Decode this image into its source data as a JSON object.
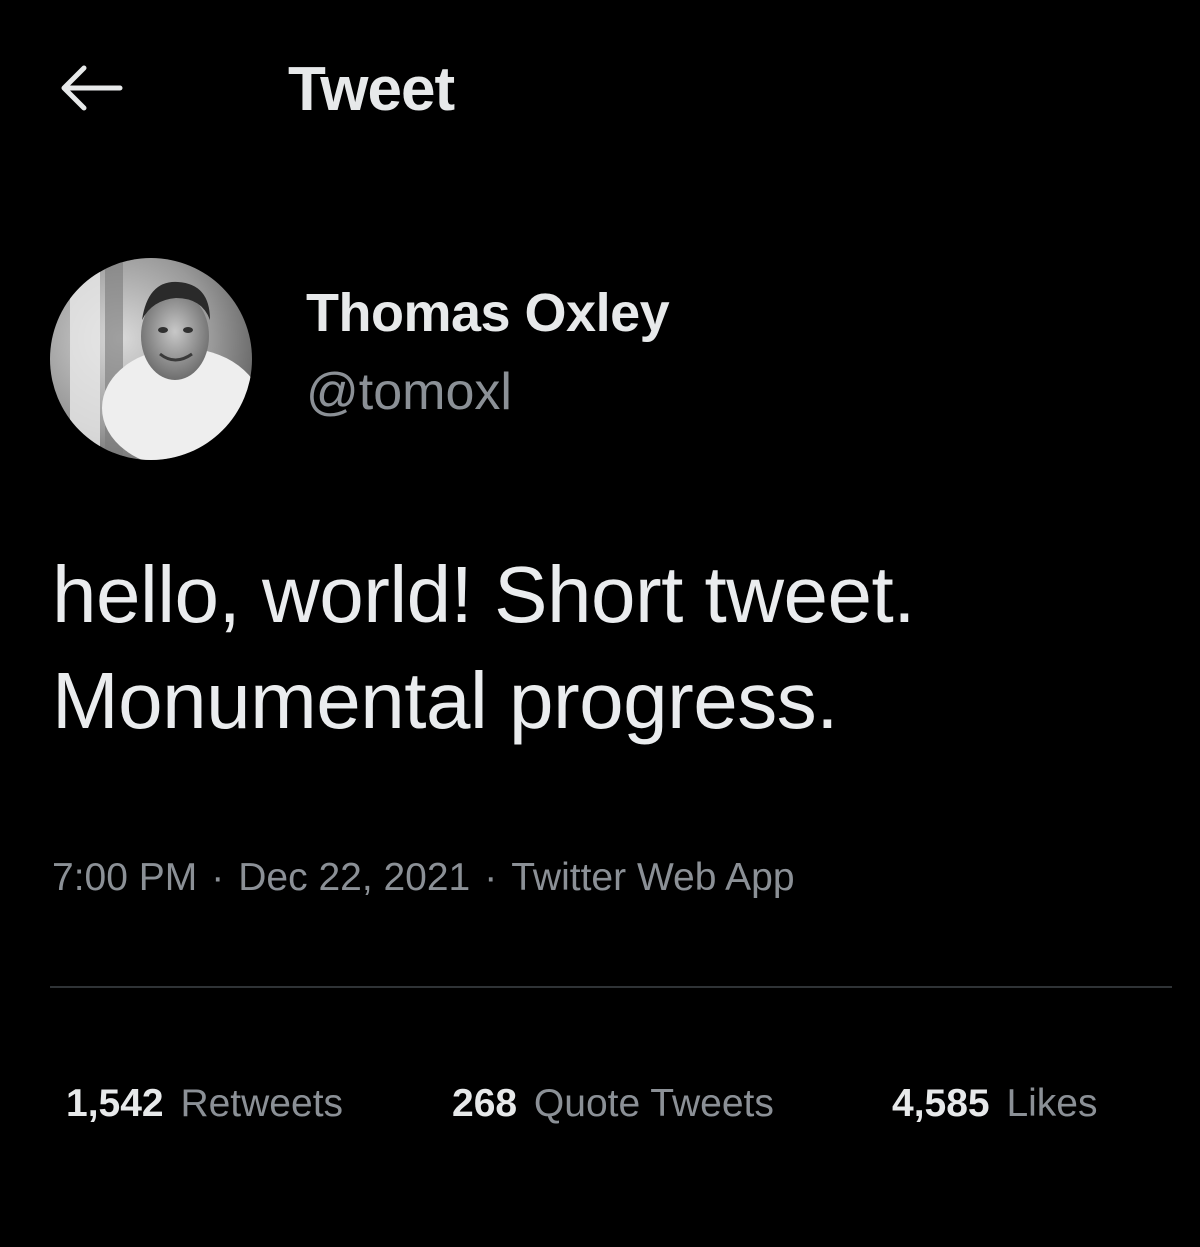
{
  "header": {
    "back_icon": "arrow-left-icon",
    "title": "Tweet"
  },
  "author": {
    "avatar_icon": "profile-photo",
    "display_name": "Thomas Oxley",
    "handle": "@tomoxl"
  },
  "tweet": {
    "text_line1": "hello, world! Short tweet.",
    "text_line2": "Monumental progress."
  },
  "meta": {
    "time": "7:00 PM",
    "separator1": "·",
    "date": "Dec 22, 2021",
    "separator2": "·",
    "source": "Twitter Web App"
  },
  "stats": {
    "retweets_count": "1,542",
    "retweets_label": "Retweets",
    "quotes_count": "268",
    "quotes_label": "Quote Tweets",
    "likes_count": "4,585",
    "likes_label": "Likes"
  },
  "colors": {
    "background": "#000000",
    "primary_text": "#e7e9ea",
    "secondary_text": "#8b9096",
    "divider": "#2f3336"
  }
}
